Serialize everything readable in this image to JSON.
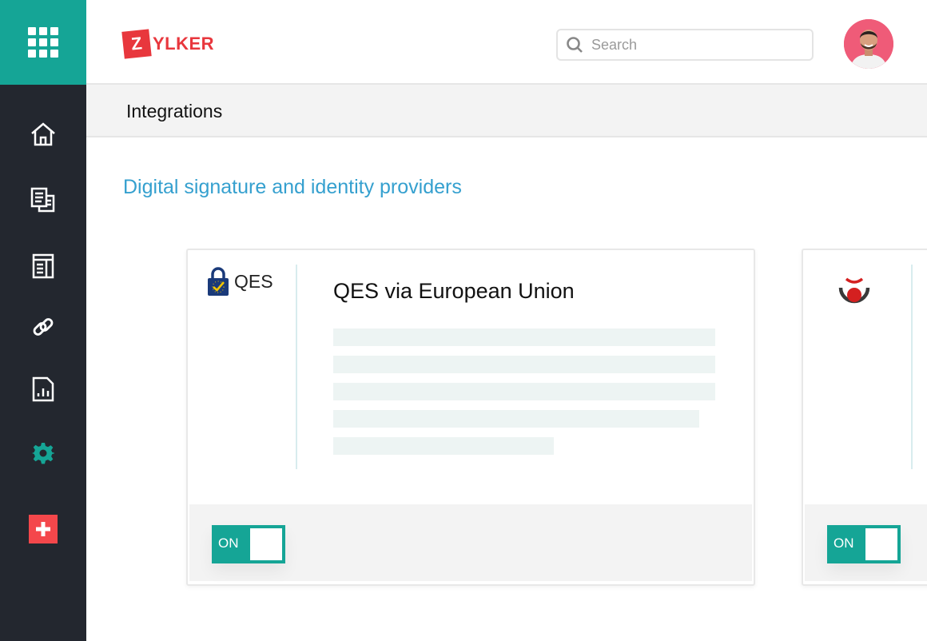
{
  "brand": {
    "logo_letter": "Z",
    "logo_rest": "YLKER",
    "accent": "#15a596",
    "logo_color": "#e8373d"
  },
  "sidebar": {
    "items": [
      {
        "id": "home",
        "icon": "home-icon"
      },
      {
        "id": "documents",
        "icon": "documents-icon"
      },
      {
        "id": "templates",
        "icon": "template-icon"
      },
      {
        "id": "integrations",
        "icon": "link-icon"
      },
      {
        "id": "reports",
        "icon": "report-icon"
      },
      {
        "id": "settings",
        "icon": "gear-icon",
        "active": true
      }
    ],
    "add_icon": "plus-icon"
  },
  "header": {
    "search_placeholder": "Search"
  },
  "page": {
    "title": "Integrations",
    "section_title": "Digital signature and identity providers"
  },
  "cards": [
    {
      "logo_text": "QES",
      "title": "QES via European Union",
      "toggle_label": "ON",
      "enabled": true
    },
    {
      "logo_text": "",
      "title": "",
      "toggle_label": "ON",
      "enabled": true
    }
  ]
}
